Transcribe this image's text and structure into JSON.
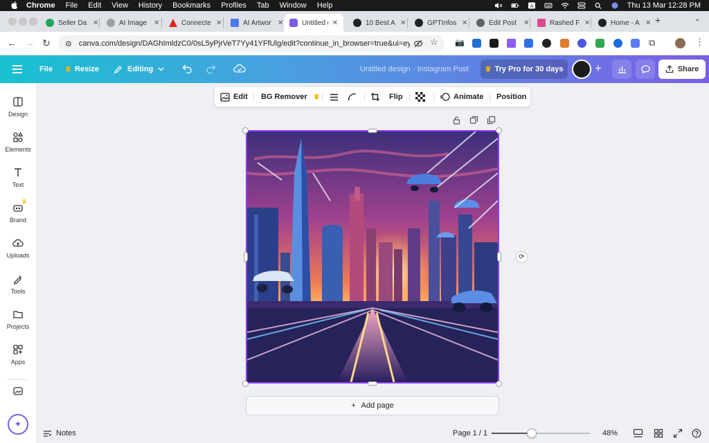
{
  "menubar": {
    "app": "Chrome",
    "items": [
      "File",
      "Edit",
      "View",
      "History",
      "Bookmarks",
      "Profiles",
      "Tab",
      "Window",
      "Help"
    ],
    "datetime": "Thu 13 Mar  12:28 PM"
  },
  "tabs": [
    {
      "label": "Seller Da",
      "color": "#22a45a"
    },
    {
      "label": "AI Image",
      "color": "#9aa0a6"
    },
    {
      "label": "Connecte",
      "color": "#e0251b"
    },
    {
      "label": "AI Artwor",
      "color": "#4b7bec"
    },
    {
      "label": "Untitled d",
      "color": "#7b5be6",
      "active": true
    },
    {
      "label": "10 Best A",
      "color": "#202124"
    },
    {
      "label": "GPTInfos",
      "color": "#202124"
    },
    {
      "label": "Edit Post",
      "color": "#5f6368"
    },
    {
      "label": "Rashed F",
      "color": "#d84a8c"
    },
    {
      "label": "Home - A",
      "color": "#202124"
    }
  ],
  "address": {
    "url": "canva.com/design/DAGhImldzC0/0sL5yPjrVeT7Yy41YFfUlg/edit?continue_in_browser=true&ui=eyJF..."
  },
  "header": {
    "file_label": "File",
    "resize_label": "Resize",
    "editing_label": "Editing",
    "doc_title": "Untitled design - Instagram Post",
    "try_pro_label": "Try Pro for 30 days",
    "share_label": "Share"
  },
  "sidebar": {
    "items": [
      {
        "label": "Design",
        "icon": "design-icon"
      },
      {
        "label": "Elements",
        "icon": "elements-icon"
      },
      {
        "label": "Text",
        "icon": "text-icon"
      },
      {
        "label": "Brand",
        "icon": "brand-icon"
      },
      {
        "label": "Uploads",
        "icon": "uploads-icon"
      },
      {
        "label": "Tools",
        "icon": "tools-icon"
      },
      {
        "label": "Projects",
        "icon": "projects-icon"
      },
      {
        "label": "Apps",
        "icon": "apps-icon"
      }
    ]
  },
  "toolbar": {
    "edit_label": "Edit",
    "bg_remover_label": "BG Remover",
    "flip_label": "Flip",
    "animate_label": "Animate",
    "position_label": "Position"
  },
  "canvas": {
    "add_page_label": "Add page"
  },
  "footer": {
    "notes_label": "Notes",
    "page_label": "Page 1 / 1",
    "zoom_label": "48%",
    "zoom_fraction": 0.41
  },
  "colors": {
    "accent": "#8b3dff",
    "header_start": "#17c1d0",
    "header_end": "#7a5fe6"
  }
}
